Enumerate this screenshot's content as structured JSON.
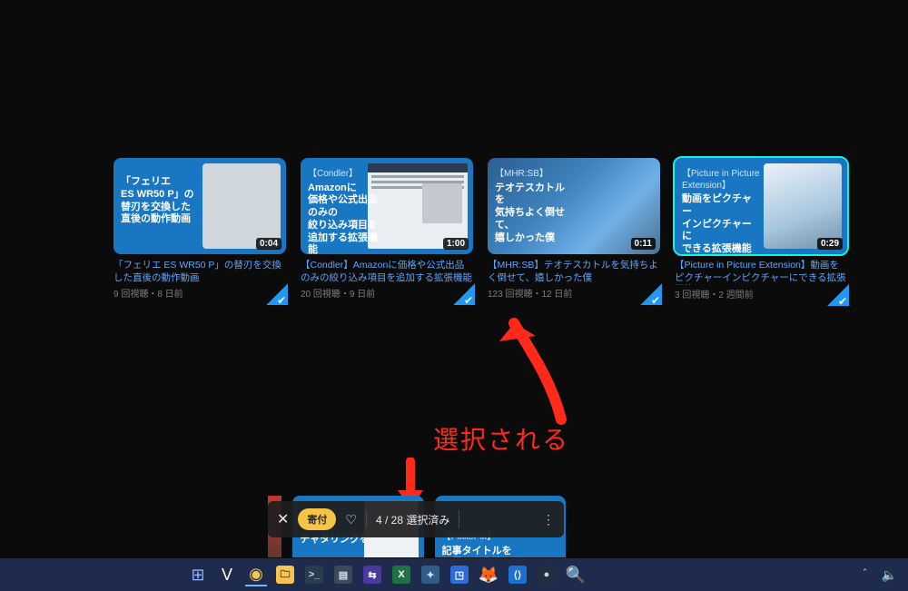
{
  "annotation": {
    "label": "選択される"
  },
  "selection_toolbar": {
    "donate_label": "寄付",
    "count_text": "4 / 28  選択済み"
  },
  "videos": [
    {
      "thumb_header": "",
      "thumb_text": "「フェリエ\nES WR50 P」の\n替刃を交換した\n直後の動作動画",
      "duration": "0:04",
      "title": "「フェリエ ES WR50 P」の替刃を交換した直後の動作動画",
      "stats": "9 回視聴・8 日前",
      "highlight": false,
      "inset": "plain"
    },
    {
      "thumb_header": "【Condler】",
      "thumb_text": "Amazonに\n価格や公式出品のみの\n絞り込み項目を\n追加する拡張機能",
      "duration": "1:00",
      "title": "【Condler】Amazonに価格や公式出品のみの絞り込み項目を追加する拡張機能",
      "stats": "20 回視聴・9 日前",
      "highlight": false,
      "inset": "browser"
    },
    {
      "thumb_header": "【MHR:SB】",
      "thumb_text": "テオテスカトルを\n気持ちよく倒せて、\n嬉しかった僕",
      "duration": "0:11",
      "title": "【MHR:SB】テオテスカトルを気持ちよく倒せて、嬉しかった僕",
      "stats": "123 回視聴・12 日前",
      "highlight": false,
      "inset": "game"
    },
    {
      "thumb_header": "【Picture in Picture Extension】",
      "thumb_text": "動画をピクチャー\nインピクチャーに\nできる拡張機能",
      "duration": "0:29",
      "title": "【Picture in Picture Extension】動画をピクチャーインピクチャーにできる拡張機能",
      "stats": "3 回視聴・2 週間前",
      "highlight": true,
      "inset": "ext"
    }
  ],
  "lower_cards": [
    {
      "thumb_header": "",
      "thumb_text": "チャタリングを"
    },
    {
      "thumb_header": "【PolitePol】",
      "thumb_text": "記事タイトルを\n取得する方法"
    }
  ],
  "taskbar": {
    "icons": [
      {
        "name": "start-icon",
        "glyph": "⊞",
        "bg": "transparent",
        "fg": "#8ab4ff",
        "active": false
      },
      {
        "name": "vivaldi-icon",
        "glyph": "V",
        "bg": "transparent",
        "fg": "#ffffff",
        "active": false
      },
      {
        "name": "chrome-icon",
        "glyph": "◉",
        "bg": "transparent",
        "fg": "#f2c94c",
        "active": true
      },
      {
        "name": "explorer-icon",
        "glyph": "🗀",
        "bg": "#f5c451",
        "fg": "#2b2b2b",
        "active": false
      },
      {
        "name": "terminal-icon",
        "glyph": ">_",
        "bg": "#2b3b52",
        "fg": "#cfd6dc",
        "active": false
      },
      {
        "name": "app-icon-1",
        "glyph": "▤",
        "bg": "#3a4a5a",
        "fg": "#d0e0ef",
        "active": false
      },
      {
        "name": "app-icon-2",
        "glyph": "⇆",
        "bg": "#4a3aa0",
        "fg": "#ffffff",
        "active": false
      },
      {
        "name": "excel-icon",
        "glyph": "X",
        "bg": "#1f7244",
        "fg": "#ffffff",
        "active": false
      },
      {
        "name": "app-icon-3",
        "glyph": "✦",
        "bg": "#2f5d87",
        "fg": "#cfe3f3",
        "active": false
      },
      {
        "name": "app-icon-4",
        "glyph": "◳",
        "bg": "#2d6bd6",
        "fg": "#ffffff",
        "active": false
      },
      {
        "name": "firefox-icon",
        "glyph": "🦊",
        "bg": "transparent",
        "fg": "#ff8a33",
        "active": false
      },
      {
        "name": "vscode-icon",
        "glyph": "⟨⟩",
        "bg": "#1f6fd0",
        "fg": "#ffffff",
        "active": false
      },
      {
        "name": "app-icon-5",
        "glyph": "●",
        "bg": "#203040",
        "fg": "#cfd6dc",
        "active": false
      },
      {
        "name": "search-icon",
        "glyph": "🔍",
        "bg": "transparent",
        "fg": "#f0a030",
        "active": false
      }
    ]
  }
}
